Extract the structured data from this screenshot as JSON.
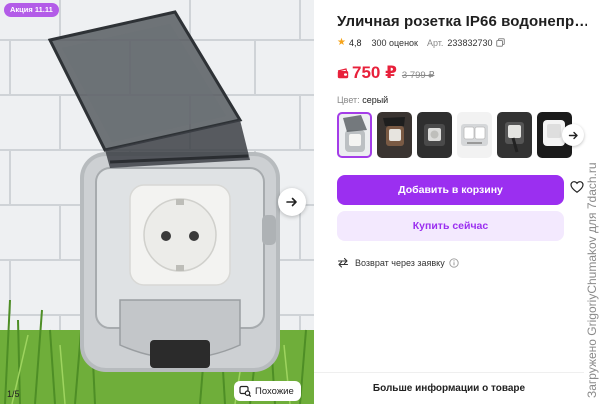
{
  "photo": {
    "promo_badge": "Акция 11.11",
    "counter": "1/5",
    "similar_label": "Похожие"
  },
  "product": {
    "title": "Уличная розетка IP66 водонепр…",
    "rating": "4,8",
    "reviews": "300 оценок",
    "article_label": "Арт.",
    "article_number": "233832730",
    "price": "750 ₽",
    "old_price": "3 799 ₽",
    "color_label": "Цвет:",
    "color_value": "серый"
  },
  "actions": {
    "add_to_cart": "Добавить в корзину",
    "buy_now": "Купить сейчас",
    "return_label": "Возврат через заявку"
  },
  "footer": {
    "more_info": "Больше информации о товаре"
  },
  "watermark": "Загружено GrigoriyChumakov для 7dach.ru",
  "colors": {
    "accent": "#9b2ff0",
    "accent_light": "#f3e9fe",
    "price_red": "#e8213b",
    "promo_badge": "#b35ce8",
    "star": "#f6a41b"
  }
}
